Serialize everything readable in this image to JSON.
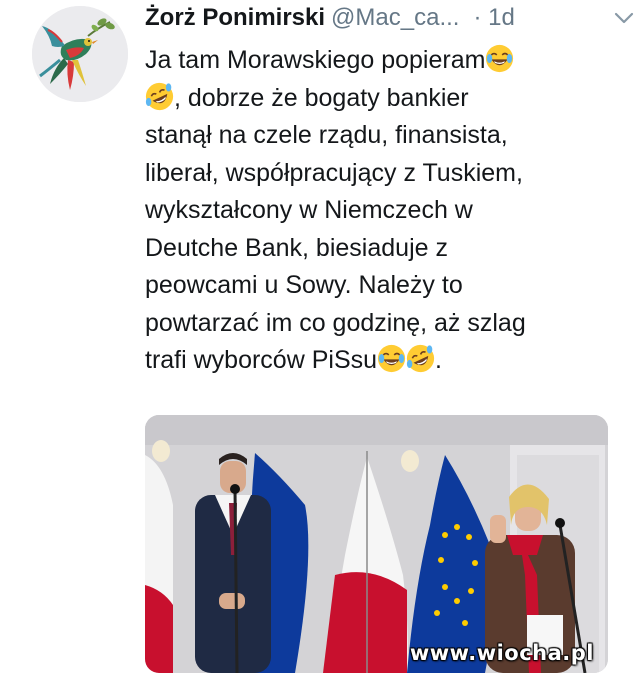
{
  "tweet": {
    "display_name": "Żorż Ponimirski",
    "handle": "@Mac_ca...",
    "separator_and_time": "· 1d",
    "text_lines": [
      "Ja tam Morawskiego popieram",
      ", dobrze że bogaty bankier",
      "stanął na czele rządu,  finansista,",
      "liberał, współpracujący z Tuskiem,",
      "wykształcony w Niemczech w",
      "Deutche Bank, biesiaduje z",
      "peowcami u Sowy. Należy to",
      "powtarzać im co godzinę, aż szlag",
      "trafi wyborców PiSsu",
      "."
    ],
    "emojis": [
      "face-with-tears-of-joy-icon",
      "rolling-on-floor-laughing-icon"
    ],
    "more_icon": "chevron-down-icon"
  },
  "media": {
    "watermark": "www.wiocha.pl"
  },
  "colors": {
    "text": "#14171a",
    "secondary": "#657786",
    "background": "#ffffff"
  }
}
